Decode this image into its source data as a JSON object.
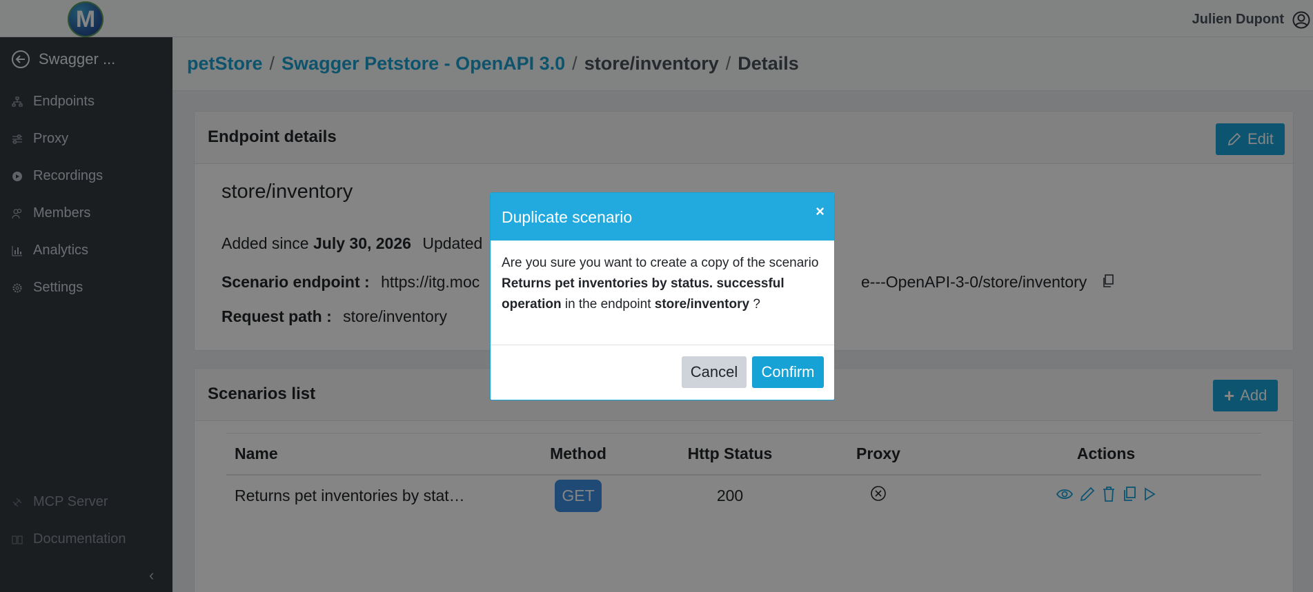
{
  "header": {
    "logo_letter": "M",
    "user_name": "Julien Dupont"
  },
  "sidebar": {
    "back_label": "Swagger ...",
    "items": [
      {
        "label": "Endpoints",
        "icon": "sitemap-icon"
      },
      {
        "label": "Proxy",
        "icon": "sliders-icon"
      },
      {
        "label": "Recordings",
        "icon": "play-circle-icon"
      },
      {
        "label": "Members",
        "icon": "people-icon"
      },
      {
        "label": "Analytics",
        "icon": "bar-chart-icon"
      },
      {
        "label": "Settings",
        "icon": "gear-icon"
      }
    ],
    "bottom_items": [
      {
        "label": "MCP Server",
        "icon": "plug-icon"
      },
      {
        "label": "Documentation",
        "icon": "book-icon"
      }
    ]
  },
  "breadcrumb": {
    "items": [
      "petStore",
      "Swagger Petstore - OpenAPI 3.0",
      "store/inventory",
      "Details"
    ],
    "separator": "/"
  },
  "endpoint_card": {
    "title": "Endpoint details",
    "edit_label": "Edit",
    "endpoint_name": "store/inventory",
    "added_label": "Added since",
    "added_date": "July 30, 2026",
    "updated_label": "Updated",
    "scenario_endpoint_label": "Scenario endpoint :",
    "scenario_endpoint_start": "https://itg.moc",
    "scenario_endpoint_end": "e---OpenAPI-3-0/store/inventory",
    "request_path_label": "Request path :",
    "request_path": "store/inventory"
  },
  "scenarios_card": {
    "title": "Scenarios list",
    "add_label": "Add",
    "columns": [
      "Name",
      "Method",
      "Http Status",
      "Proxy",
      "Actions"
    ],
    "rows": [
      {
        "name": "Returns pet inventories by stat…",
        "method": "GET",
        "status": "200"
      }
    ]
  },
  "modal": {
    "title": "Duplicate scenario",
    "close": "×",
    "text_1": "Are you sure you want to create a copy of the scenario ",
    "scenario_name": "Returns pet inventories by status. successful operation",
    "text_2": " in the endpoint ",
    "endpoint_name": "store/inventory",
    "text_3": " ?",
    "cancel_label": "Cancel",
    "confirm_label": "Confirm"
  },
  "colors": {
    "primary": "#17a2d6",
    "sidebar_bg": "#343a40",
    "method_get": "#3b8ee0"
  }
}
